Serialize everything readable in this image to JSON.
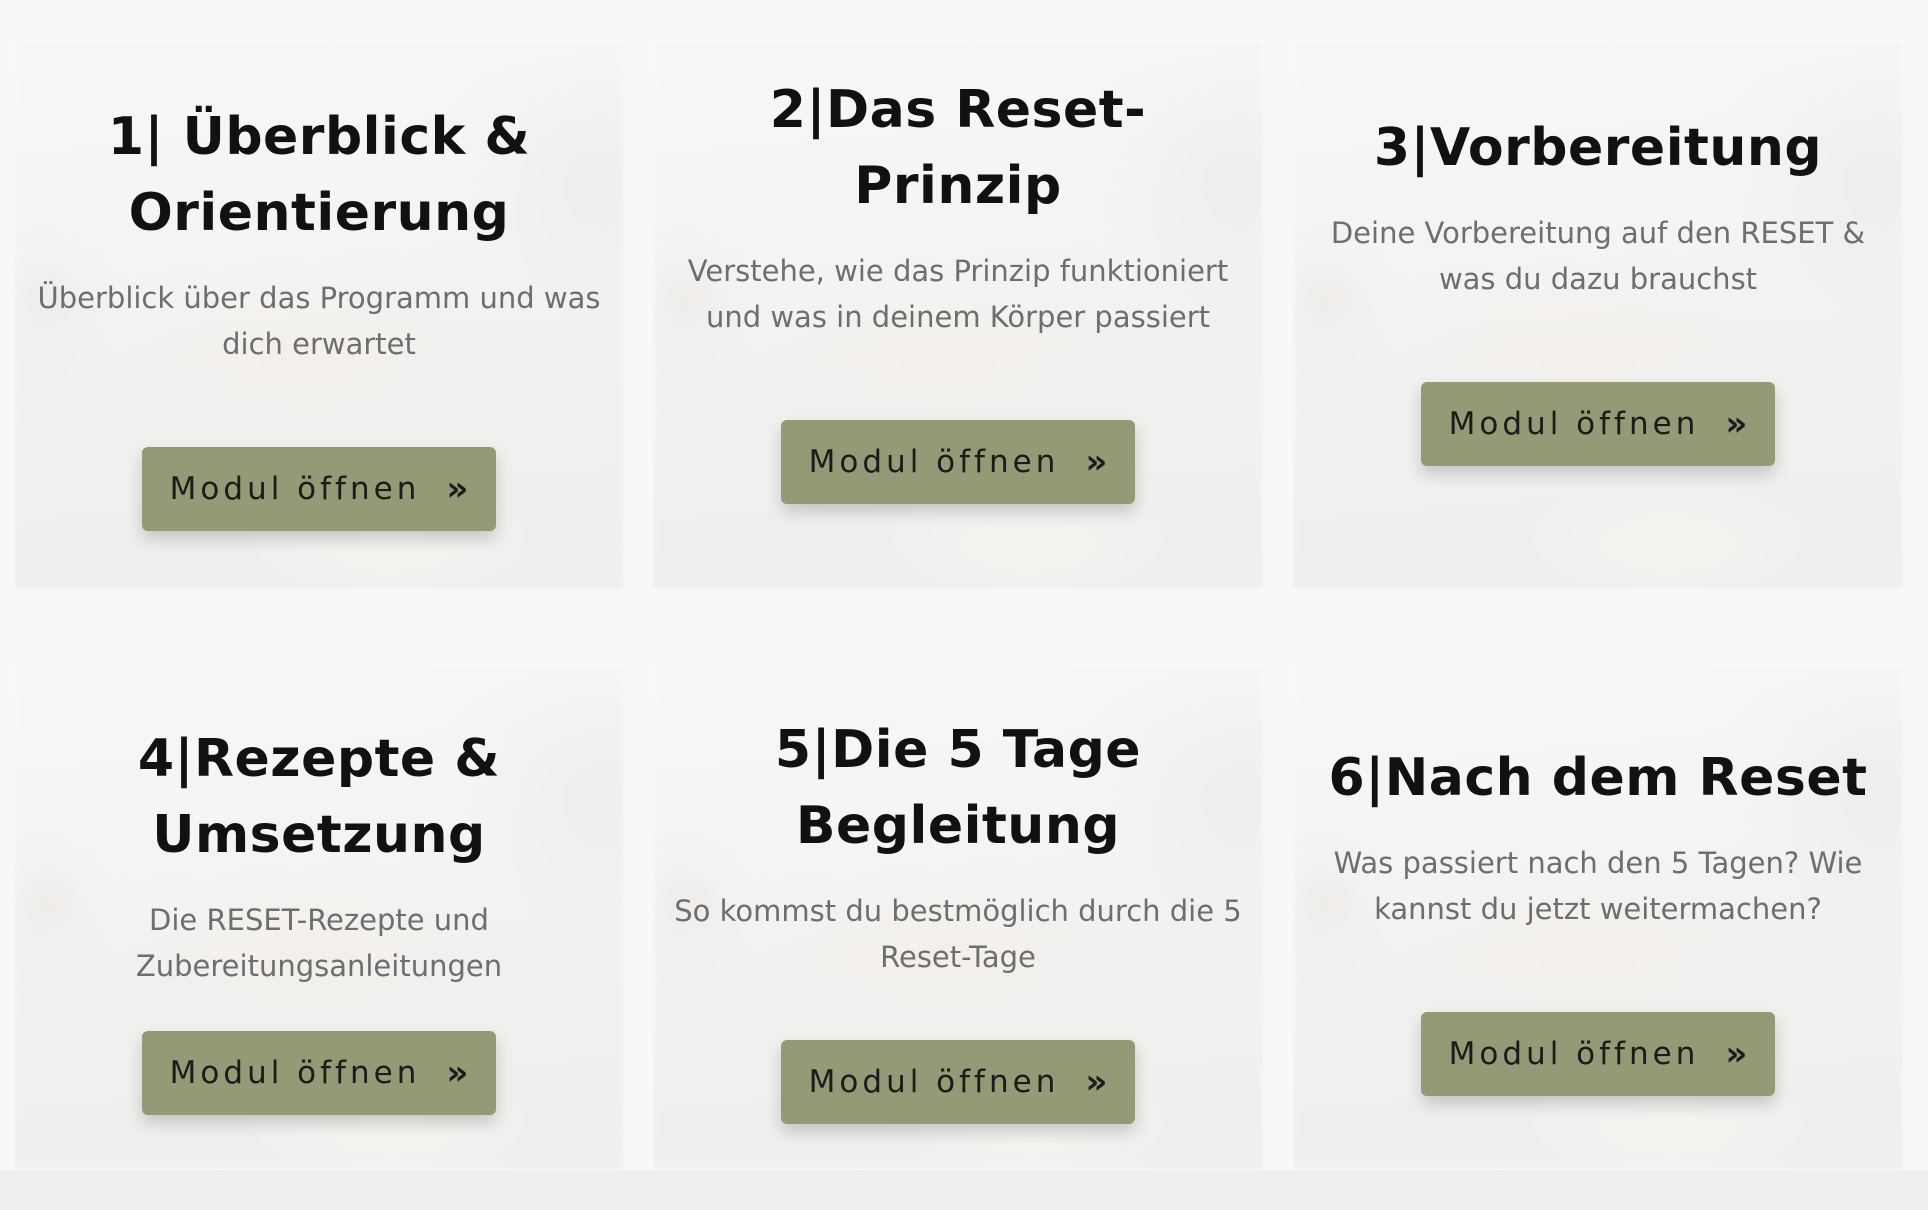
{
  "modules": [
    {
      "title_line1": "1| Überblick &",
      "title_line2": "Orientierung",
      "description": "Überblick über das Programm und was dich erwartet",
      "button_label": "Modul öffnen",
      "button_icon": "»"
    },
    {
      "title_line1": "2|Das Reset-Prinzip",
      "title_line2": "",
      "description": "Verstehe, wie das Prinzip funktioniert und was in deinem Körper passiert",
      "button_label": "Modul öffnen",
      "button_icon": "»"
    },
    {
      "title_line1": "3|Vorbereitung",
      "title_line2": "",
      "description": "Deine Vorbereitung auf den RESET & was du dazu brauchst",
      "button_label": "Modul öffnen",
      "button_icon": "»"
    },
    {
      "title_line1": "4|Rezepte &",
      "title_line2": "Umsetzung",
      "description": "Die RESET-Rezepte und Zubereitungsanleitungen",
      "button_label": "Modul öffnen",
      "button_icon": "»"
    },
    {
      "title_line1": "5|Die 5 Tage",
      "title_line2": "Begleitung",
      "description": "So kommst du bestmöglich durch die 5 Reset-Tage",
      "button_label": "Modul öffnen",
      "button_icon": "»"
    },
    {
      "title_line1": "6|Nach dem Reset",
      "title_line2": "",
      "description": "Was passiert nach den 5 Tagen? Wie kannst du jetzt weitermachen?",
      "button_label": "Modul öffnen",
      "button_icon": "»"
    }
  ],
  "colors": {
    "page_background": "#f7f8fa",
    "button_background": "#939b76",
    "title_text": "#111111",
    "description_text": "#6e6e6e"
  },
  "icons": {
    "button_icon_name": "double-chevron-right-icon"
  }
}
